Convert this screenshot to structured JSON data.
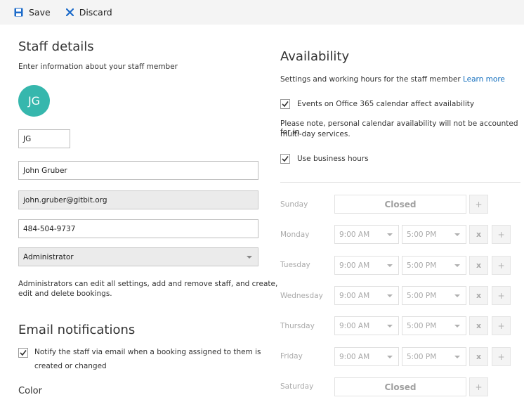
{
  "toolbar": {
    "save_label": "Save",
    "discard_label": "Discard"
  },
  "staff": {
    "title": "Staff details",
    "subtitle": "Enter information about your staff member",
    "avatar_initials": "JG",
    "avatar_color": "#36b7ad",
    "initials": "JG",
    "name": "John Gruber",
    "email": "john.gruber@gitbit.org",
    "phone": "484-504-9737",
    "role": "Administrator",
    "role_note_line1": "Administrators can edit all settings, add and remove staff, and create,",
    "role_note_line2": "edit and delete bookings."
  },
  "email_notifications": {
    "title": "Email notifications",
    "notify_line1": "Notify the staff via email when a booking assigned to them is",
    "notify_line2": "created or changed",
    "notify_checked": true
  },
  "color_section": {
    "title": "Color"
  },
  "availability": {
    "title": "Availability",
    "subtitle": "Settings and working hours for the staff member",
    "learn_more": "Learn more",
    "office365_label": "Events on Office 365 calendar affect availability",
    "office365_checked": true,
    "note_line1": "Please note, personal calendar availability will not be accounted for in",
    "note_line2": "multi-day services.",
    "business_hours_label": "Use business hours",
    "business_hours_checked": true,
    "closed_label": "Closed",
    "add_symbol": "+",
    "remove_symbol": "x",
    "days": {
      "sunday": {
        "name": "Sunday"
      },
      "monday": {
        "name": "Monday",
        "start": "9:00 AM",
        "end": "5:00 PM"
      },
      "tuesday": {
        "name": "Tuesday",
        "start": "9:00 AM",
        "end": "5:00 PM"
      },
      "wednesday": {
        "name": "Wednesday",
        "start": "9:00 AM",
        "end": "5:00 PM"
      },
      "thursday": {
        "name": "Thursday",
        "start": "9:00 AM",
        "end": "5:00 PM"
      },
      "friday": {
        "name": "Friday",
        "start": "9:00 AM",
        "end": "5:00 PM"
      },
      "saturday": {
        "name": "Saturday"
      }
    }
  },
  "colors": {
    "accent": "#0f6cbd",
    "save_icon": "#1b6ac9",
    "discard_icon": "#1b6ac9"
  }
}
